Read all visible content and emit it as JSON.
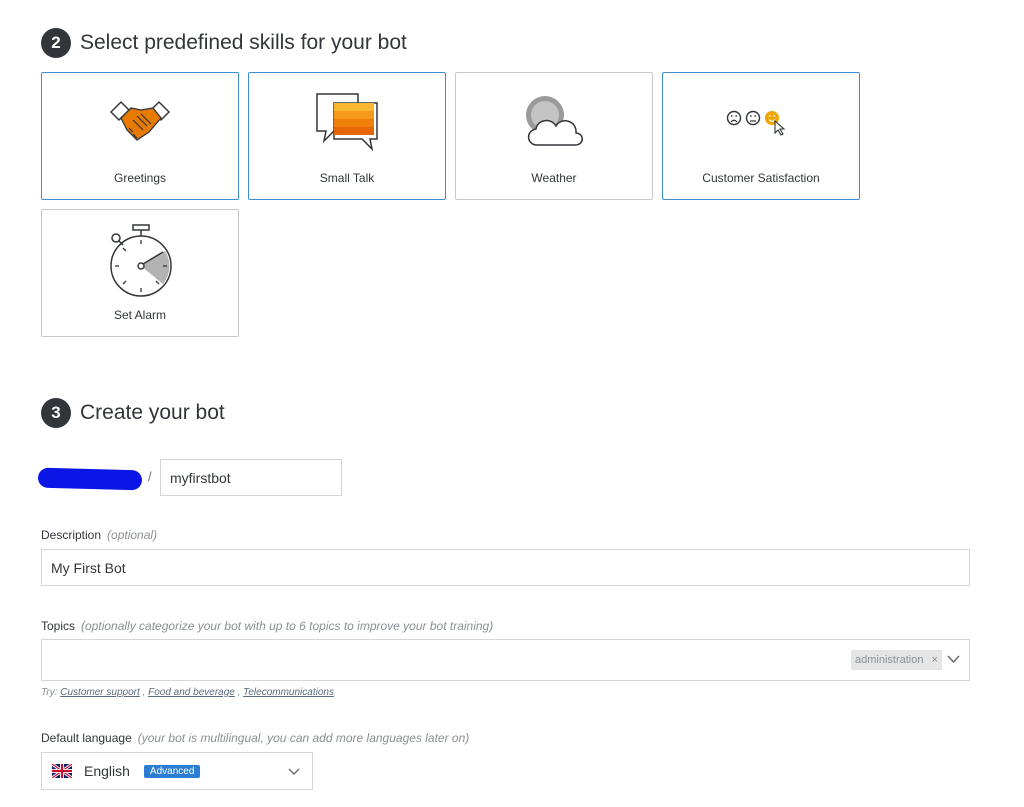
{
  "step2": {
    "number": "2",
    "title": "Select predefined skills for your bot"
  },
  "skills": [
    {
      "label": "Greetings",
      "icon": "handshake-icon",
      "selected": true
    },
    {
      "label": "Small Talk",
      "icon": "chat-bubbles-icon",
      "selected": true
    },
    {
      "label": "Weather",
      "icon": "cloud-icon",
      "selected": false
    },
    {
      "label": "Customer Satisfaction",
      "icon": "smileys-icon",
      "selected": true
    },
    {
      "label": "Set Alarm",
      "icon": "stopwatch-icon",
      "selected": false
    }
  ],
  "step3": {
    "number": "3",
    "title": "Create your bot"
  },
  "bot": {
    "separator": "/",
    "name": "myfirstbot"
  },
  "description": {
    "label": "Description",
    "hint": "(optional)",
    "value": "My First Bot"
  },
  "topics": {
    "label": "Topics",
    "hint": "(optionally categorize your bot with up to 6 topics to improve your bot training)",
    "tag": "administration",
    "tag_remove": "×",
    "try_prefix": "Try:",
    "suggestions": [
      "Customer support",
      "Food and beverage",
      "Telecommunications"
    ]
  },
  "language": {
    "label": "Default language",
    "hint": "(your bot is multilingual, you can add more languages later on)",
    "value": "English",
    "badge": "Advanced",
    "flag": "uk-flag-icon"
  },
  "colors": {
    "accent": "#3d8fd6",
    "orange": "#e87a00",
    "dark": "#32363a",
    "badge": "#2b7cd3",
    "redaction": "#0a16e6"
  }
}
